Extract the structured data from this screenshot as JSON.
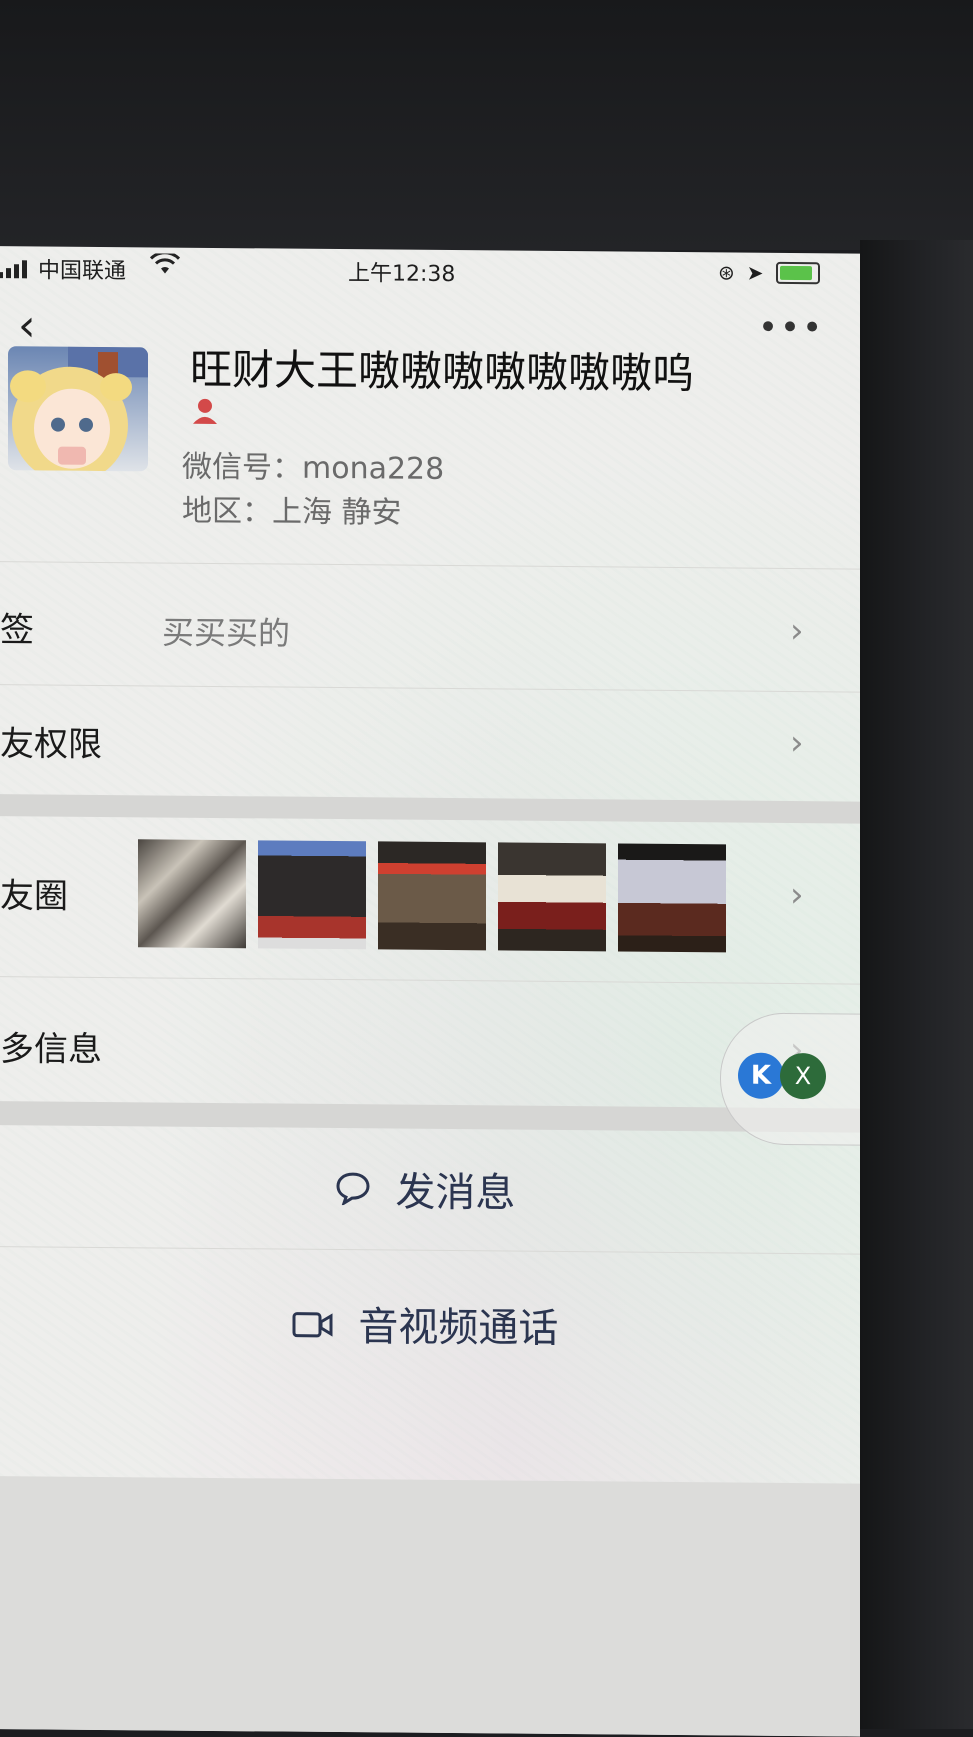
{
  "status_bar": {
    "carrier": "中国联通",
    "time": "上午12:38"
  },
  "profile": {
    "name": "旺财大王嗷嗷嗷嗷嗷嗷嗷呜",
    "wechat_id": "微信号：mona228",
    "region": "地区：上海 静安"
  },
  "rows": {
    "tags_label": "标签",
    "tags_value": "买买买的",
    "permissions_label": "朋友权限",
    "moments_label": "朋友圈",
    "more_label": "更多信息"
  },
  "actions": {
    "send_message": "发消息",
    "video_call": "音视频通话"
  },
  "floating": {
    "k_label": "K",
    "x_label": "X"
  },
  "icons": {
    "back": "chevron-left-icon",
    "more": "more-dots-icon",
    "gender": "person-icon",
    "chat": "chat-bubble-icon",
    "video": "video-camera-icon"
  },
  "colors": {
    "accent_text": "#2b3550",
    "battery": "#5bc24a",
    "gender_icon": "#d34949"
  }
}
